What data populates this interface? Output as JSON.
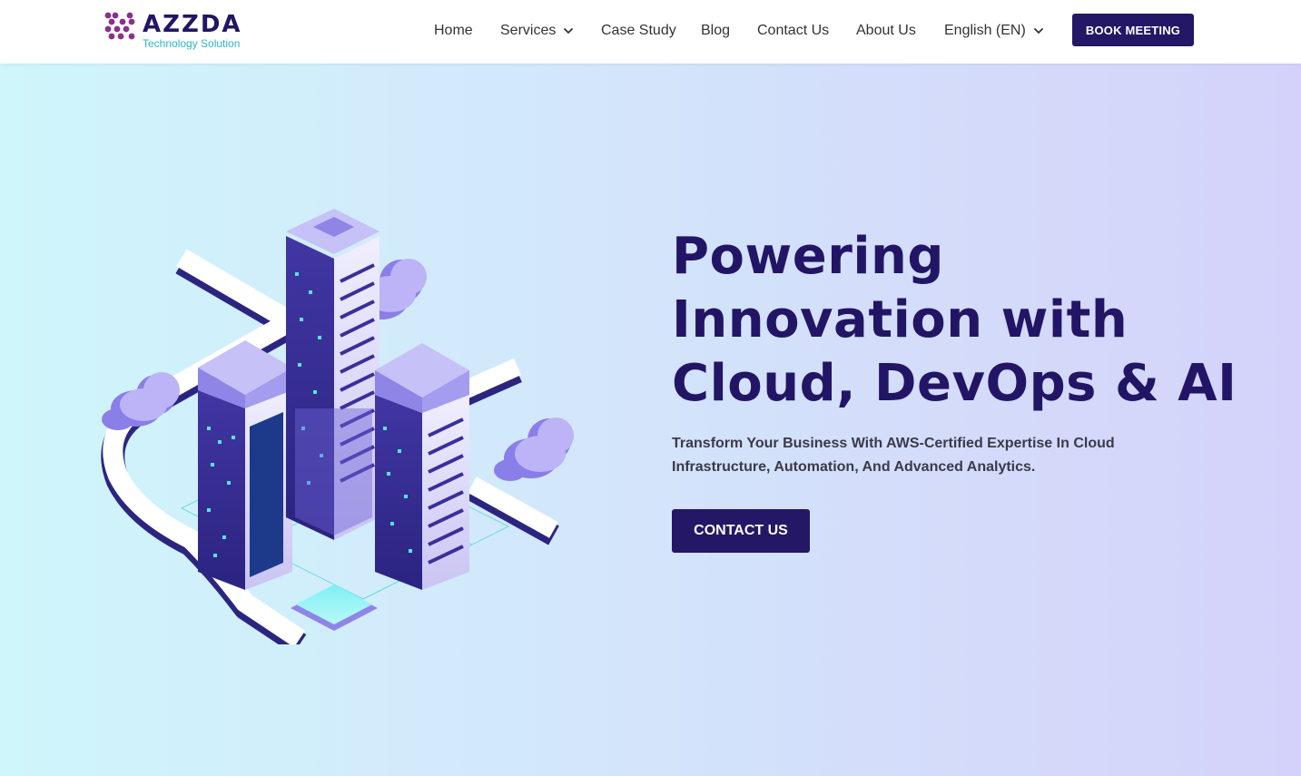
{
  "brand": {
    "name": "AZZDA",
    "tagline": "Technology Solution",
    "logo_icon": "dot-grid-logo-icon",
    "colors": {
      "primary": "#231766",
      "accent": "#2bb7c6",
      "logo_dots": "#8b2f8f"
    }
  },
  "nav": {
    "items": [
      {
        "label": "Home"
      },
      {
        "label": "Services",
        "icon": "chevron-down-icon"
      },
      {
        "label": "Case Study"
      },
      {
        "label": "Blog"
      },
      {
        "label": "Contact Us"
      },
      {
        "label": "About Us"
      },
      {
        "label": "English (EN)",
        "icon": "chevron-down-icon"
      }
    ],
    "cta_label": "BOOK MEETING"
  },
  "hero": {
    "headline_lines": [
      "Powering",
      "Innovation with",
      "Cloud, DevOps & AI"
    ],
    "subtext_lines": [
      "Transform Your Business With AWS-Certified Expertise In Cloud",
      "Infrastructure, Automation, And Advanced Analytics."
    ],
    "cta_label": "CONTACT US",
    "illustration": "isometric-server-towers-illustration"
  }
}
